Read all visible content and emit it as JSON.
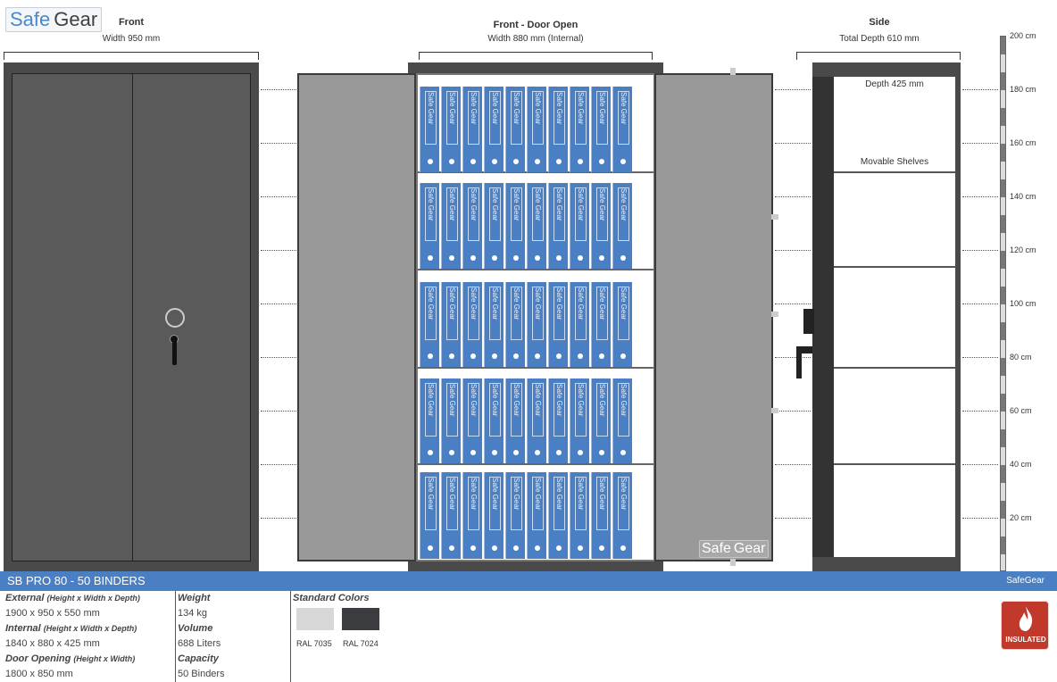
{
  "logo": {
    "part1": "Safe",
    "part2": "Gear"
  },
  "views": {
    "front": {
      "title": "Front",
      "subtitle": "Width 950 mm"
    },
    "open": {
      "title": "Front - Door Open",
      "subtitle": "Width 880 mm (Internal)"
    },
    "side": {
      "title": "Side",
      "subtitle": "Total Depth 610 mm",
      "depth_label": "Depth 425 mm",
      "shelves_label": "Movable Shelves"
    }
  },
  "binder_label": "Safe Gear",
  "binder_rows": 5,
  "binders_per_row": 10,
  "door_logo": {
    "part1": "Safe",
    "part2": "Gear"
  },
  "ruler": {
    "unit": "cm",
    "ticks": [
      "200 cm",
      "180 cm",
      "160 cm",
      "140 cm",
      "120 cm",
      "100 cm",
      "80 cm",
      "60 cm",
      "40 cm",
      "20 cm"
    ]
  },
  "product": {
    "title": "SB PRO 80 - 50 BINDERS",
    "brand_small": "SafeGear"
  },
  "specs": {
    "external_label": "External",
    "external_note": "(Height x Width x Depth)",
    "external_value": "1900 x 950 x 550 mm",
    "internal_label": "Internal",
    "internal_note": "(Height x Width x Depth)",
    "internal_value": "1840 x 880 x 425 mm",
    "door_label": "Door Opening",
    "door_note": "(Height x Width)",
    "door_value": "1800 x 850 mm",
    "weight_label": "Weight",
    "weight_value": "134 kg",
    "volume_label": "Volume",
    "volume_value": "688 Liters",
    "capacity_label": "Capacity",
    "capacity_value": "50 Binders"
  },
  "colors": {
    "label": "Standard Colors",
    "items": [
      {
        "name": "RAL 7035",
        "hex": "#d7d7d7"
      },
      {
        "name": "RAL 7024",
        "hex": "#3b3c40"
      }
    ]
  },
  "badge": {
    "text": "INSULATED",
    "color": "#c0392b",
    "icon": "flame-icon"
  }
}
